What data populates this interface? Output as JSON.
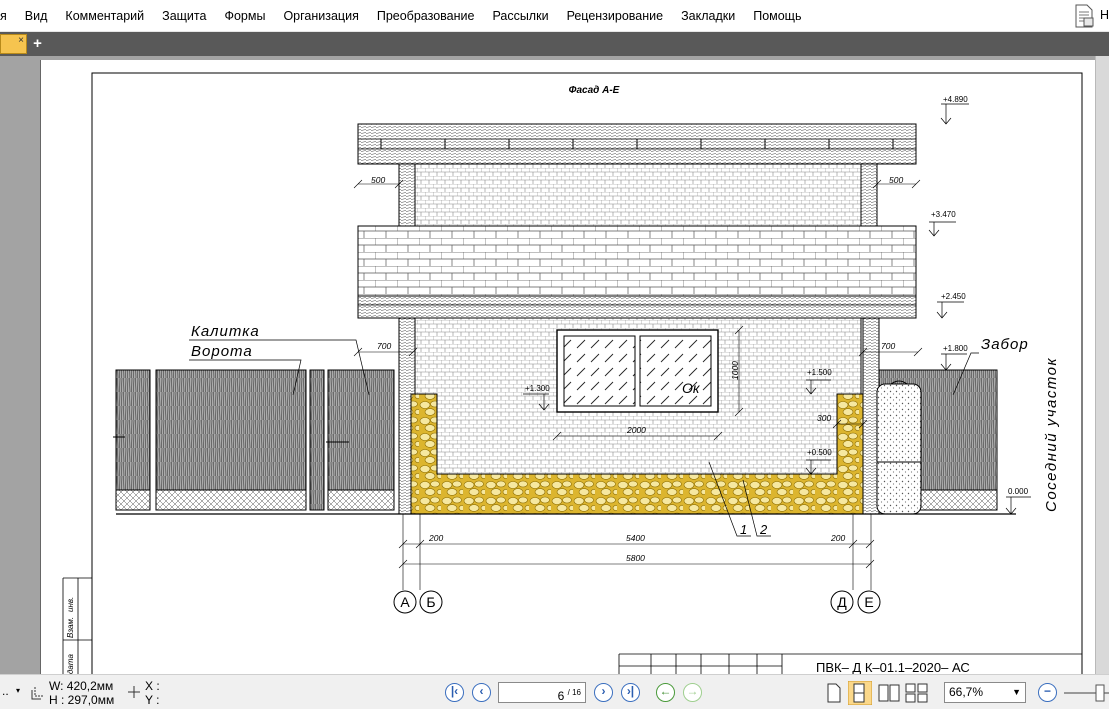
{
  "menubar": {
    "items": [
      "я",
      "Вид",
      "Комментарий",
      "Защита",
      "Формы",
      "Организация",
      "Преобразование",
      "Рассылки",
      "Рецензирование",
      "Закладки",
      "Помощь"
    ],
    "trailing_text": "Н"
  },
  "tabbar": {
    "close_glyph": "×",
    "new_tab_glyph": "+"
  },
  "drawing": {
    "title": "Фасад А-Е",
    "labels": {
      "gate_small": "Калитка",
      "gate": "Ворота",
      "fence": "Забор",
      "neighbor": "Соседний участок",
      "window_mark": "Ок"
    },
    "elevations": {
      "e4890": "+4.890",
      "e3470": "+3.470",
      "e2450": "+2.450",
      "e1800": "+1.800",
      "e1500": "+1.500",
      "e1300": "+1.300",
      "e0500": "+0.500",
      "e0000": "0.000"
    },
    "dims": {
      "d500_left": "500",
      "d500_right": "500",
      "d700_left": "700",
      "d700_right": "700",
      "d1000": "1000",
      "d2000": "2000",
      "d300": "300",
      "d200_left": "200",
      "d5400": "5400",
      "d200_right": "200",
      "d5800": "5800"
    },
    "callouts": {
      "c1": "1",
      "c2": "2"
    },
    "axes": [
      "А",
      "Б",
      "Д",
      "Е"
    ],
    "stamp_side": [
      "инв.",
      "Взам.",
      "дата"
    ],
    "stamp_title": "ПВК– Д К–01.1–2020– АС"
  },
  "statusbar": {
    "left_dots": "..",
    "width_label": "W: 420,2мм",
    "height_label": "H : 297,0мм",
    "x_label": "X :",
    "y_label": "Y :",
    "page_current": "6",
    "page_total": "/ 16",
    "zoom_value": "66,7%"
  }
}
